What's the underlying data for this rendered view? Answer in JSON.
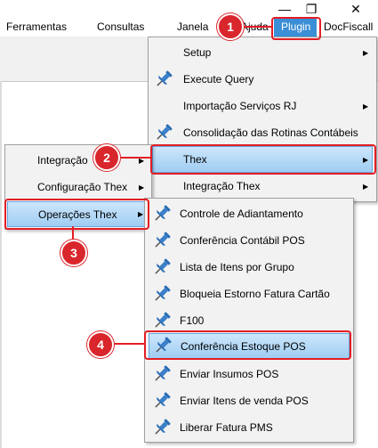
{
  "window_controls": {
    "minimize": "—",
    "restore": "❐",
    "close": "✕"
  },
  "menubar": {
    "items": [
      "Ferramentas",
      "Consultas",
      "Janela",
      "Ajuda",
      "Plugin",
      "DocFiscall"
    ]
  },
  "plugin_menu": {
    "items": [
      {
        "label": "Setup",
        "submenu": true,
        "icon": null
      },
      {
        "label": "Execute Query",
        "submenu": false,
        "icon": "pin-icon"
      },
      {
        "label": "Importação Serviços RJ",
        "submenu": true,
        "icon": null
      },
      {
        "label": "Consolidação das Rotinas Contábeis",
        "submenu": false,
        "icon": "pin-icon"
      },
      {
        "label": "Thex",
        "submenu": true,
        "icon": null,
        "highlighted": true
      },
      {
        "label": "Integração Thex",
        "submenu": true,
        "icon": null
      }
    ]
  },
  "thex_menu": {
    "items": [
      {
        "label": "Integração",
        "submenu": true
      },
      {
        "label": "Configuração Thex",
        "submenu": true
      },
      {
        "label": "Operações Thex",
        "submenu": true,
        "highlighted": true
      }
    ]
  },
  "operacoes_menu": {
    "items": [
      {
        "label": "Controle de Adiantamento",
        "icon": "pin-icon"
      },
      {
        "label": "Conferência Contábil POS",
        "icon": "pin-icon"
      },
      {
        "label": "Lista de Itens por Grupo",
        "icon": "pin-icon"
      },
      {
        "label": "Bloqueia Estorno Fatura Cartão",
        "icon": "pin-icon"
      },
      {
        "label": "F100",
        "icon": "pin-icon"
      },
      {
        "label": "Conferência Estoque POS",
        "icon": "pin-icon",
        "highlighted": true
      },
      {
        "label": "Enviar Insumos POS",
        "icon": "pin-icon"
      },
      {
        "label": "Enviar Itens de venda POS",
        "icon": "pin-icon"
      },
      {
        "label": "Liberar Fatura PMS",
        "icon": "pin-icon"
      }
    ]
  },
  "annotations": [
    "1",
    "2",
    "3",
    "4"
  ],
  "colors": {
    "highlight": "#9fcdf3",
    "annotation_red": "#e31e24",
    "pin_blue": "#2a6db5"
  }
}
